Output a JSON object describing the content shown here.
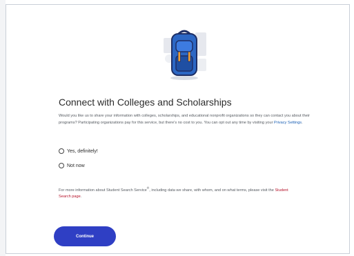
{
  "page": {
    "title": "Connect with Colleges and Scholarships",
    "description": "Would you like us to share your information with colleges, scholarships, and educational nonprofit organizations so they can contact you about their programs? Participating organizations pay for this service, but there's no cost to you. You can opt out any time by visiting your ",
    "privacy_link": "Privacy Settings",
    "description_end": ".",
    "options": [
      {
        "label": "Yes, definitely!"
      },
      {
        "label": "Not now"
      }
    ],
    "more_info_prefix": "For more information about Student Search Service",
    "more_info_mark": "®",
    "more_info_middle": ", including data we share, with whom, and on what terms, please visit the ",
    "student_search_link": "Student Search page",
    "more_info_end": ".",
    "continue_label": "Continue"
  },
  "colors": {
    "accent": "#2f3fc4",
    "backpack_blue": "#2c67c4",
    "backpack_orange": "#f0a23a",
    "link_blue": "#1a5fb4",
    "link_red": "#b5122a"
  },
  "icons": {
    "illustration": "backpack-icon"
  }
}
